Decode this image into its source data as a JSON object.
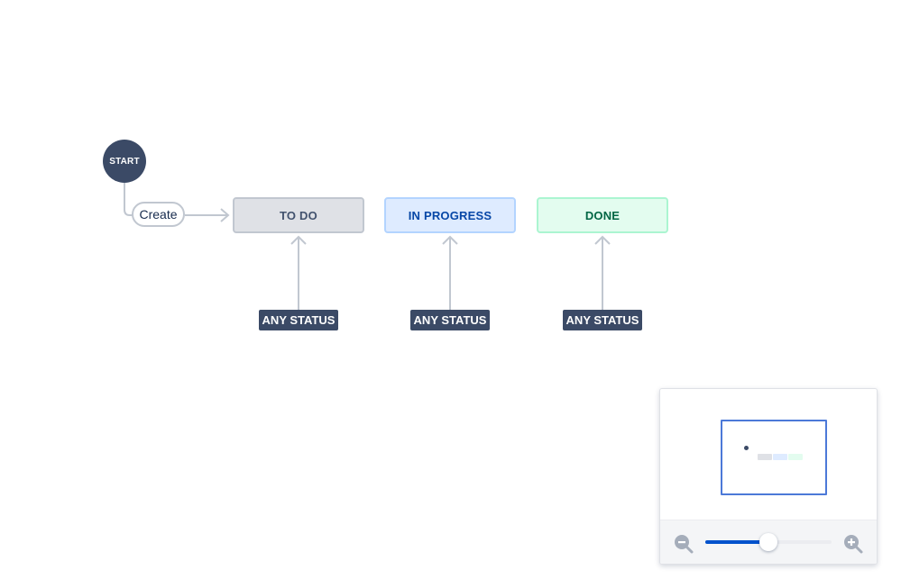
{
  "workflow": {
    "start_label": "START",
    "transition_label": "Create",
    "statuses": [
      {
        "label": "TO DO",
        "color": "#dfe1e6"
      },
      {
        "label": "IN PROGRESS",
        "color": "#deebff"
      },
      {
        "label": "DONE",
        "color": "#e3fcef"
      }
    ],
    "any_status_labels": [
      "ANY STATUS",
      "ANY STATUS",
      "ANY STATUS"
    ]
  },
  "zoom": {
    "level_fraction": 0.5,
    "zoom_out_icon": "zoom-out-icon",
    "zoom_in_icon": "zoom-in-icon",
    "accent": "#0052cc"
  }
}
